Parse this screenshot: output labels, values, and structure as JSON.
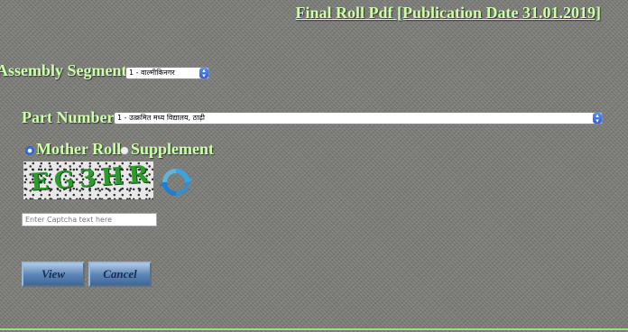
{
  "header": {
    "title": "Final Roll Pdf [Publication Date 31.01.2019]"
  },
  "assembly": {
    "label": "Assembly Segment",
    "value": "1 - वाल्मीकिनगर"
  },
  "part": {
    "label": "Part Number",
    "value": "1 - उत्क्रमित मध्य विद्यालय, ठाढ़ी"
  },
  "roll_type": {
    "option1": "Mother Roll",
    "option2": "Supplement",
    "selected": "Mother Roll"
  },
  "captcha": {
    "text": "EG3HR"
  },
  "captcha_input": {
    "placeholder": "Enter Captcha text here"
  },
  "buttons": {
    "view": "View",
    "cancel": "Cancel"
  },
  "colors": {
    "label": "#ccffaa",
    "accent": "#2f6fe0",
    "button": "#5f88b8"
  }
}
